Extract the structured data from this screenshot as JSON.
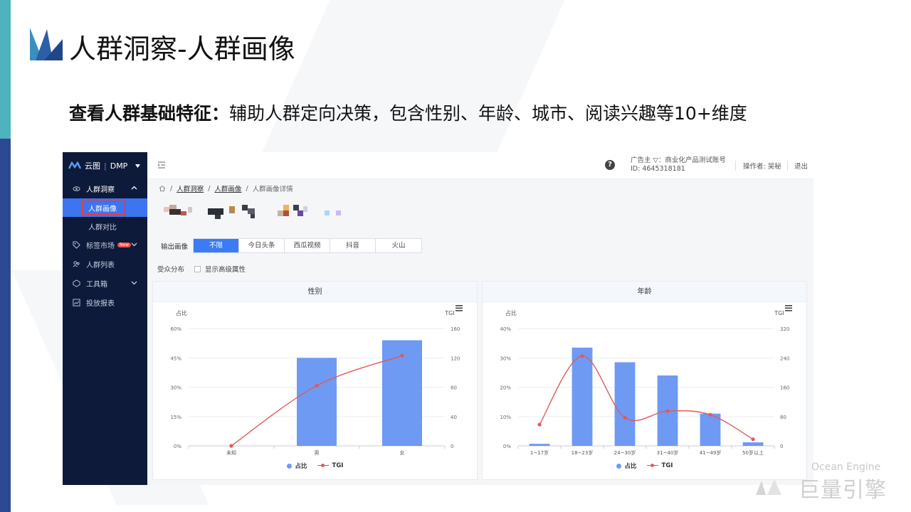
{
  "slide": {
    "title": "人群洞察-人群画像",
    "subtitle_bold": "查看人群基础特征：",
    "subtitle_rest": "辅助人群定向决策，包含性别、年龄、城市、阅读兴趣等10+维度"
  },
  "sidebar": {
    "brand": "云图",
    "brand_sub": "DMP",
    "items": [
      {
        "label": "人群洞察",
        "icon": "eye-icon"
      },
      {
        "label": "人群画像"
      },
      {
        "label": "人群对比"
      },
      {
        "label": "标签市场",
        "badge": "New",
        "icon": "tag-icon"
      },
      {
        "label": "人群列表",
        "icon": "users-icon"
      },
      {
        "label": "工具箱",
        "icon": "toolbox-icon"
      },
      {
        "label": "投放报表",
        "icon": "report-icon"
      }
    ]
  },
  "topbar": {
    "advertiser_line1": "广告主 ▽：商业化产品测试账号",
    "advertiser_line2": "ID: 4645318181",
    "operator": "操作者: 吴秘",
    "logout": "退出",
    "help": "?"
  },
  "breadcrumb": [
    "人群洞察",
    "人群画像",
    "人群画像详情"
  ],
  "filters": {
    "output_label": "输出画像",
    "options": [
      "不限",
      "今日头条",
      "西瓜视频",
      "抖音",
      "火山"
    ],
    "selected": "不限",
    "distribution_label": "受众分布",
    "advanced_label": "显示高级属性"
  },
  "chart_data": [
    {
      "type": "bar",
      "title": "性别",
      "categories": [
        "未知",
        "男",
        "女"
      ],
      "series": [
        {
          "name": "占比",
          "type": "bar",
          "values": [
            0,
            45,
            54
          ]
        },
        {
          "name": "TGI",
          "type": "line",
          "values": [
            0,
            82,
            123
          ]
        }
      ],
      "ylabel_left": "占比",
      "ylabel_right": "TGI",
      "yticks_left": [
        "0%",
        "15%",
        "30%",
        "45%",
        "60%"
      ],
      "yticks_right": [
        "0",
        "40",
        "80",
        "120",
        "160"
      ],
      "ylim_left": [
        0,
        60
      ],
      "ylim_right": [
        0,
        160
      ],
      "legend": [
        "占比",
        "TGI"
      ]
    },
    {
      "type": "bar",
      "title": "年龄",
      "categories": [
        "1~17岁",
        "18~23岁",
        "24~30岁",
        "31~40岁",
        "41~49岁",
        "50岁以上"
      ],
      "series": [
        {
          "name": "占比",
          "type": "bar",
          "values": [
            0.7,
            33.5,
            28.5,
            24,
            11,
            1.2
          ]
        },
        {
          "name": "TGI",
          "type": "line",
          "values": [
            58,
            245,
            77,
            95,
            85,
            18
          ]
        }
      ],
      "ylabel_left": "占比",
      "ylabel_right": "TGI",
      "yticks_left": [
        "0%",
        "10%",
        "20%",
        "30%",
        "40%"
      ],
      "yticks_right": [
        "0",
        "80",
        "160",
        "240",
        "320"
      ],
      "ylim_left": [
        0,
        40
      ],
      "ylim_right": [
        0,
        320
      ],
      "legend": [
        "占比",
        "TGI"
      ]
    }
  ],
  "watermark": {
    "en": "Ocean Engine",
    "cn": "巨量引擎"
  },
  "colors": {
    "accent": "#3b7bf6",
    "bar": "#6e9af3",
    "line": "#e05a5a",
    "sidebar": "#0d1a3a"
  }
}
